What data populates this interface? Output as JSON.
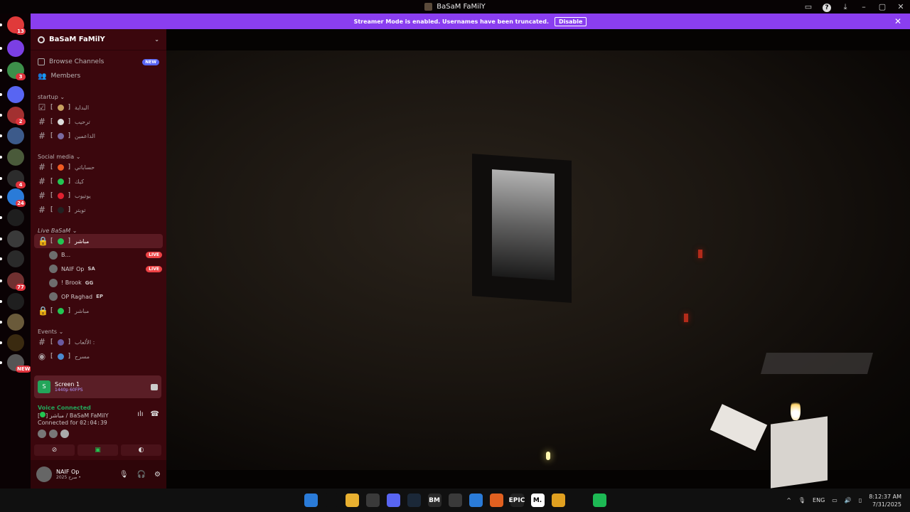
{
  "window": {
    "title": "BaSaM FaMilY"
  },
  "banner": {
    "text": "Streamer Mode is enabled. Usernames have been truncated.",
    "button": "Disable"
  },
  "servers": [
    {
      "color": "#e03a3a",
      "badge": "13"
    },
    {
      "color": "#7b3fe4",
      "badge": ""
    },
    {
      "color": "#3d8f4a",
      "badge": "3"
    },
    {
      "color": "#5865f2",
      "badge": ""
    },
    {
      "color": "#a23030",
      "badge": "2"
    },
    {
      "color": "#3c5a8a",
      "badge": ""
    },
    {
      "color": "#4a5a3a",
      "badge": ""
    },
    {
      "color": "#2c2c2c",
      "badge": "4"
    },
    {
      "color": "#2a7bd8",
      "badge": "24"
    },
    {
      "color": "#1e1e1e",
      "badge": ""
    },
    {
      "color": "#3a3a3a",
      "badge": ""
    },
    {
      "color": "#2a2a2a",
      "badge": ""
    },
    {
      "color": "#703030",
      "badge": "77"
    },
    {
      "color": "#1f1f1f",
      "badge": ""
    },
    {
      "color": "#6a5a3a",
      "badge": ""
    },
    {
      "color": "#3a2a10",
      "badge": ""
    },
    {
      "color": "#555555",
      "badge": "NEW"
    }
  ],
  "sidebar": {
    "guild_name": "BaSaM FaMilY",
    "browse": "Browse Channels",
    "browse_badge": "NEW",
    "members": "Members",
    "cat_startup": "startup",
    "startup": [
      {
        "icon": "checkbox-icon",
        "emoji": "#c8a060",
        "name": "البداية"
      },
      {
        "icon": "hash-icon",
        "emoji": "#dddddd",
        "name": "ترحيب"
      },
      {
        "icon": "hash-icon",
        "emoji": "#7a6aa0",
        "name": "الداعمين"
      }
    ],
    "cat_social": "Social media",
    "social": [
      {
        "emoji": "#f05a22",
        "name": "حساباتي"
      },
      {
        "emoji": "#23c552",
        "name": "كيك"
      },
      {
        "emoji": "#e02030",
        "name": "يوتيوب"
      },
      {
        "emoji": "#222222",
        "name": "تويتر"
      }
    ],
    "cat_live": "Live BaSaM",
    "live_channel": "مباشر",
    "users": [
      {
        "name": "B...",
        "tag": "",
        "live": "LIVE"
      },
      {
        "name": "NAIF Op",
        "tag": "SA",
        "live": "LIVE"
      },
      {
        "name": "! Brook",
        "tag": "GG",
        "live": ""
      },
      {
        "name": "OP Raghad",
        "tag": "EP",
        "live": ""
      }
    ],
    "live_channel2": "مباشر",
    "cat_events": "Events",
    "events": [
      {
        "emoji": "#6a5aa0",
        "name": "الألعاب :"
      },
      {
        "emoji": "#4a8ad0",
        "name": "مسرح"
      }
    ]
  },
  "stream": {
    "title": "Screen 1",
    "sub": "1440p 60FPS"
  },
  "voice": {
    "status": "Voice Connected",
    "location": "مباشر / BaSaM FaMilY",
    "duration_label": "Connected for",
    "duration": "02:04:39"
  },
  "user": {
    "name": "NAIF Op",
    "status": "صرح 2025 •"
  },
  "taskbar": {
    "lang": "ENG",
    "time": "8:12:37 AM",
    "date": "7/31/2025",
    "apps": [
      {
        "icon": "windows-icon",
        "color": "#2a7bd8",
        "label": ""
      },
      {
        "icon": "search-icon",
        "color": "#101010",
        "label": ""
      },
      {
        "icon": "folder-icon",
        "color": "#e8b030",
        "label": ""
      },
      {
        "icon": "chrome-icon",
        "color": "#3a3a3a",
        "label": ""
      },
      {
        "icon": "discord-icon",
        "color": "#5865f2",
        "label": ""
      },
      {
        "icon": "steam-icon",
        "color": "#1b2838",
        "label": ""
      },
      {
        "icon": "bm-icon",
        "color": "#2a2a2a",
        "label": "BM"
      },
      {
        "icon": "obs-icon",
        "color": "#3a3a3a",
        "label": ""
      },
      {
        "icon": "app-icon",
        "color": "#2a7bd8",
        "label": ""
      },
      {
        "icon": "arc-icon",
        "color": "#e06020",
        "label": ""
      },
      {
        "icon": "epic-icon",
        "color": "#222222",
        "label": "EPIC"
      },
      {
        "icon": "m-icon",
        "color": "#ffffff",
        "label": "M."
      },
      {
        "icon": "game-icon",
        "color": "#e0a020",
        "label": ""
      },
      {
        "icon": "settings-icon",
        "color": "#101010",
        "label": ""
      },
      {
        "icon": "spotify-icon",
        "color": "#1db954",
        "label": ""
      }
    ]
  }
}
